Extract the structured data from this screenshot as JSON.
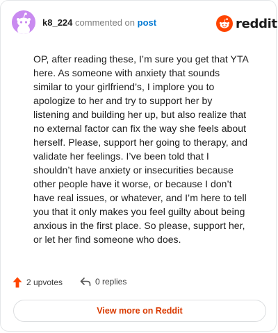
{
  "header": {
    "username": "k8_224",
    "commented_text": "commented on",
    "post_link_label": "post",
    "brand_wordmark": "reddit"
  },
  "comment": {
    "lines": [
      "OP, after reading these, I’m sure you get that YTA",
      "here. As someone with anxiety that sounds",
      "similar to your girlfriend’s, I implore you to",
      "apologize to her and try to support her by",
      "listening and building her up, but also realize that",
      "no external factor can fix the way she feels about",
      "herself. Please, support her going to therapy, and",
      "validate her feelings. I’ve been told that I",
      "shouldn’t have anxiety or insecurities because",
      "other people have it worse, or because I don’t",
      "have real issues, or whatever, and I’m here to tell",
      "you that it only makes you feel guilty about being",
      "anxious in the first place. So please, support her,",
      "or let her find someone who does."
    ]
  },
  "footer": {
    "upvotes_label": "2 upvotes",
    "replies_label": "0 replies",
    "view_more_label": "View more on Reddit"
  },
  "icons": {
    "avatar": "snoo-avatar-icon",
    "brand": "reddit-logo-icon",
    "upvote": "upvote-arrow-icon",
    "reply": "reply-arrow-icon"
  },
  "colors": {
    "avatar_bg": "#c98bf0",
    "brand_orange": "#ff4500",
    "upvote_arrow": "#ff4500",
    "view_more_text": "#d93a00",
    "post_link": "#0079d3"
  }
}
